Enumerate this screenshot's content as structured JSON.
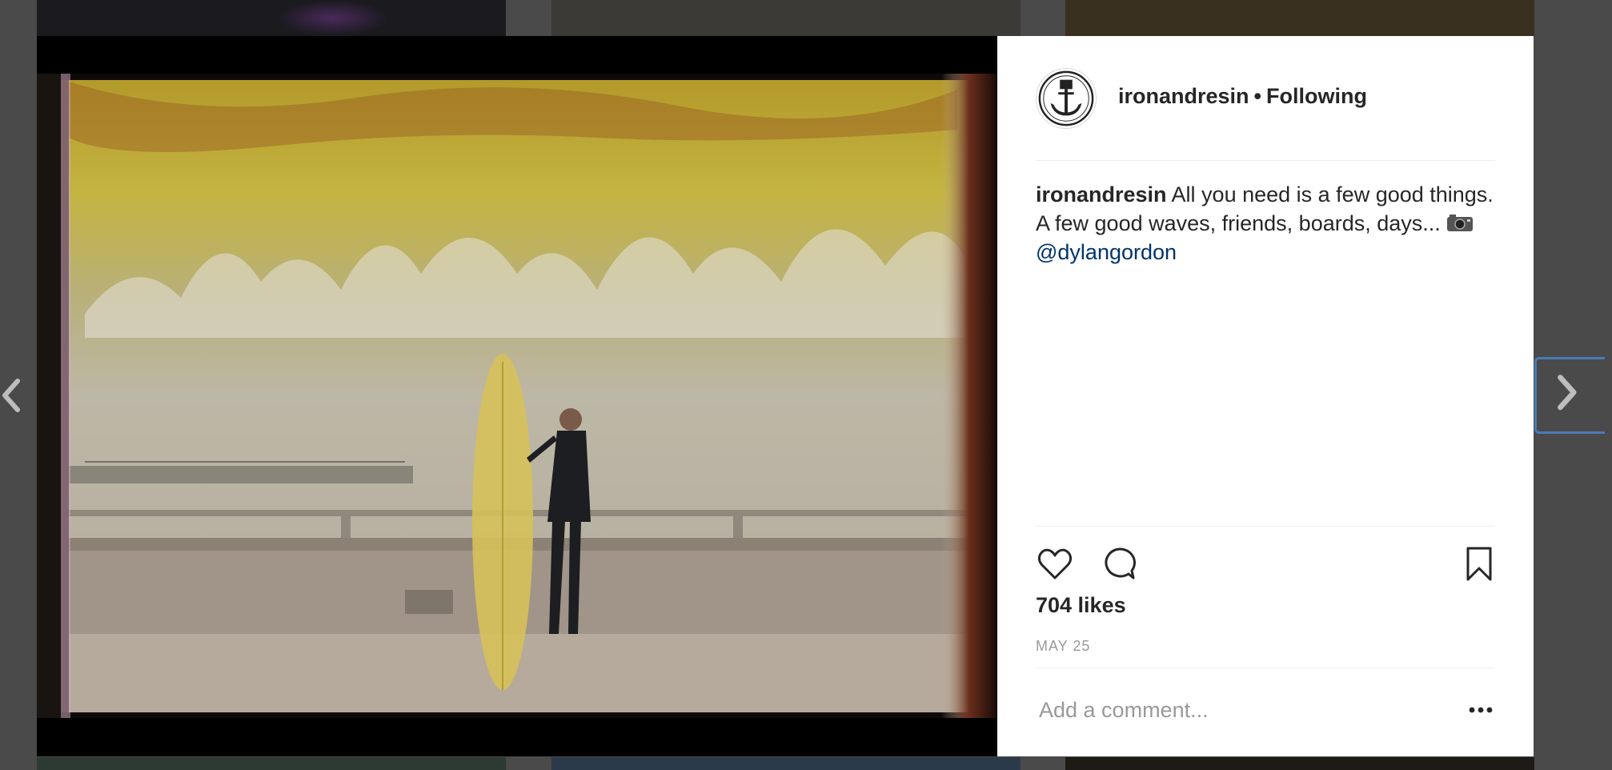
{
  "post": {
    "username": "ironandresin",
    "follow_separator": "•",
    "follow_status": "Following",
    "caption_user": "ironandresin",
    "caption_text": "All you need is a few good things. A few good waves, friends, boards, days...",
    "caption_mention": "@dylangordon",
    "likes": "704 likes",
    "date": "MAY 25"
  },
  "comment": {
    "placeholder": "Add a comment..."
  },
  "icons": {
    "like": "heart-icon",
    "comment": "comment-icon",
    "save": "bookmark-icon",
    "more": "more-options-icon",
    "prev": "chevron-left-icon",
    "next": "chevron-right-icon"
  },
  "colors": {
    "text": "#262626",
    "link": "#003569",
    "muted": "#999999",
    "overlay": "#4a4a4a"
  }
}
